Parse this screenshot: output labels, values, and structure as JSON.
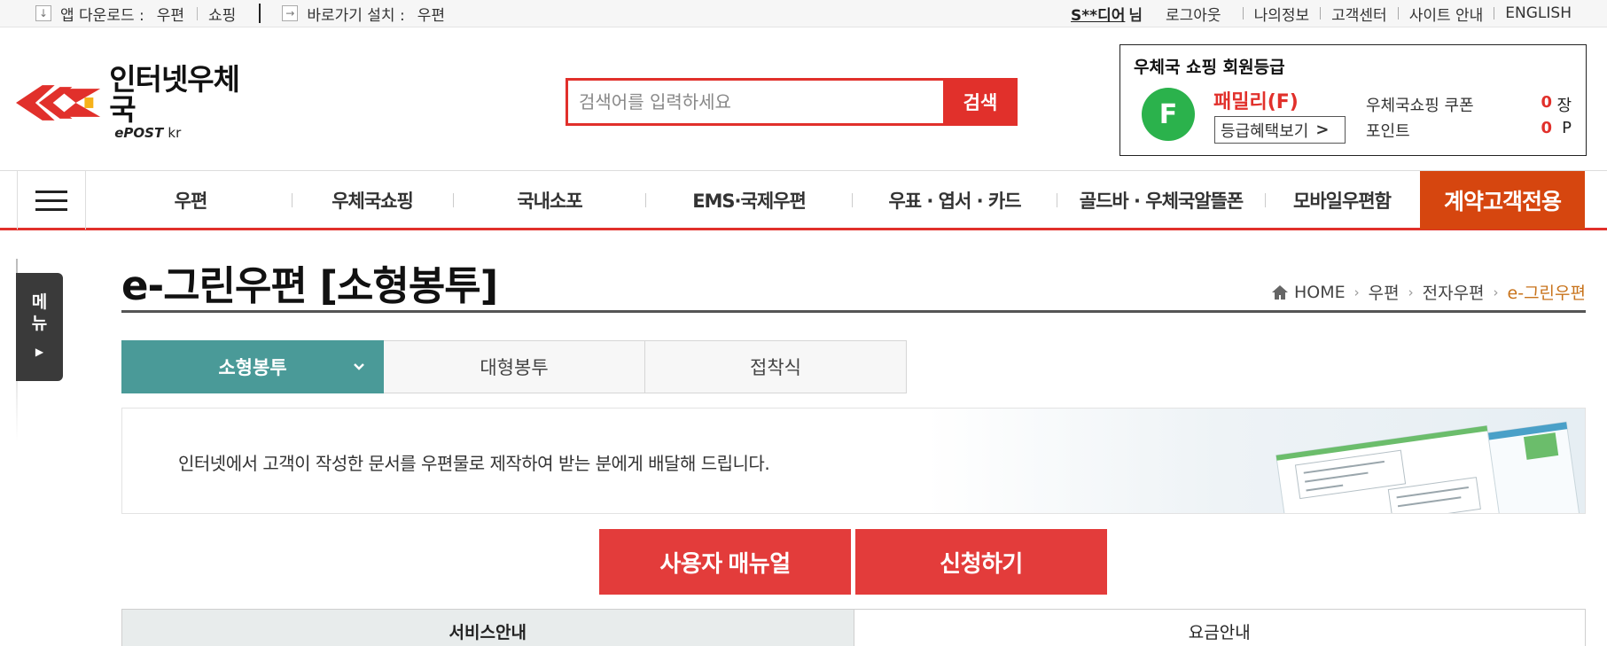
{
  "topbar": {
    "app_download_label": "앱 다운로드 :",
    "app_links": [
      "우편",
      "쇼핑"
    ],
    "shortcut_label": "바로가기 설치 :",
    "shortcut_link": "우편",
    "user_name": "S**디어",
    "user_suffix": "님",
    "logout": "로그아웃",
    "links": [
      "나의정보",
      "고객센터",
      "사이트 안내",
      "ENGLISH"
    ]
  },
  "logo": {
    "name": "인터넷우체국",
    "sub_brand": "ePOST",
    "sub_tld": "kr"
  },
  "search": {
    "placeholder": "검색어를 입력하세요",
    "button_label": "검색"
  },
  "grade": {
    "title": "우체국 쇼핑 회원등급",
    "badge_letter": "F",
    "level_name": "패밀리(F)",
    "benefit_button": "등급혜택보기",
    "coupon_label": "우체국쇼핑 쿠폰",
    "coupon_value": "0",
    "coupon_unit": "장",
    "point_label": "포인트",
    "point_value": "0",
    "point_unit": "P"
  },
  "nav": {
    "items": [
      "우편",
      "우체국쇼핑",
      "국내소포",
      "EMS·국제우편",
      "우표 · 엽서 · 카드",
      "골드바 · 우체국알뜰폰",
      "모바일우편함"
    ],
    "special": "계약고객전용"
  },
  "side_menu": {
    "label_1": "메",
    "label_2": "뉴"
  },
  "page": {
    "title": "e-그린우편 [소형봉투]",
    "breadcrumb": [
      "HOME",
      "우편",
      "전자우편",
      "e-그린우편"
    ]
  },
  "subtabs": [
    "소형봉투",
    "대형봉투",
    "접착식"
  ],
  "intro": {
    "text": "인터넷에서 고객이 작성한 문서를 우편물로 제작하여 받는 분에게 배달해 드립니다."
  },
  "actions": {
    "manual": "사용자 매뉴얼",
    "apply": "신청하기"
  },
  "bottom_tabs": [
    "서비스안내",
    "요금안내"
  ],
  "colors": {
    "brand_red": "#e1302b",
    "special_orange": "#d6460f",
    "teal_tab": "#4a9a98",
    "grade_green": "#2bb24c",
    "breadcrumb_current": "#c8731b"
  }
}
